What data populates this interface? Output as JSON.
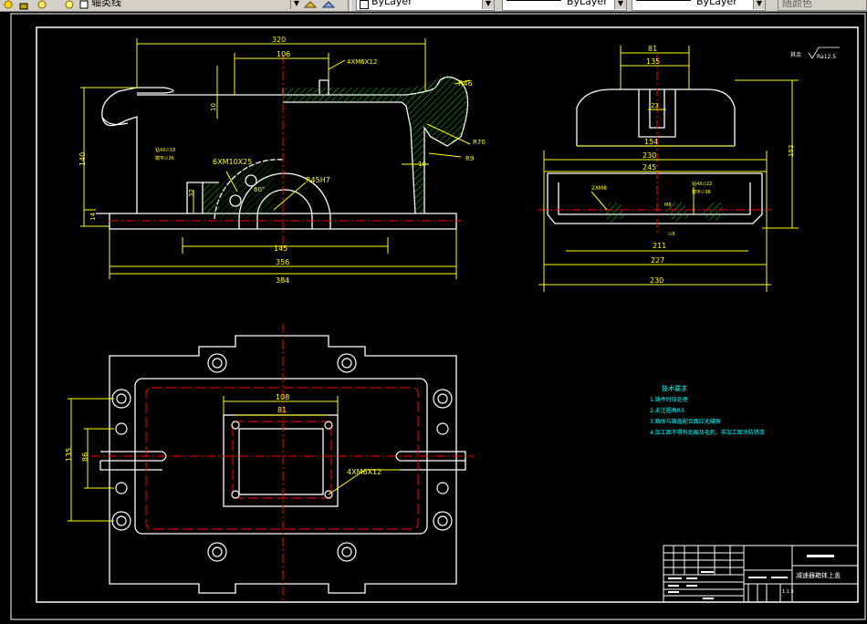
{
  "toolbar": {
    "layer_name": "轴类线",
    "color_value": "ByLayer",
    "linetype_value": "ByLayer",
    "lineweight_value": "ByLayer",
    "plotstyle_value": "随颜色"
  },
  "drawing": {
    "front_view": {
      "dim_320": "320",
      "dim_106": "106",
      "dim_4xm6x12": "4XM6X12",
      "dim_r46": "R46",
      "dim_r70": "R70",
      "dim_r9": "R9",
      "dim_10a": "10",
      "dim_10b": "10",
      "dim_140": "140",
      "dim_6xm10x25": "6XM10X25",
      "dim_60deg": "60°",
      "dim_r45h7": "R45H7",
      "dim_32": "32",
      "dim_14": "14",
      "dim_145": "145",
      "dim_356": "356",
      "dim_384": "384",
      "hole_note_1": "钻4X∅18",
      "hole_note_2": "锪平∅26"
    },
    "side_view": {
      "dim_81": "81",
      "dim_135": "135",
      "dim_23": "23",
      "dim_154": "154",
      "dim_230a": "230",
      "dim_245": "245",
      "dim_2xm8": "2XM8",
      "dim_hole_note_1": "钻4X∅22",
      "dim_hole_note_2": "锪平∅38",
      "dim_m8": "M8",
      "dim_phi8": "∅8",
      "dim_211": "211",
      "dim_227": "227",
      "dim_230b": "230",
      "dim_152": "152",
      "roughness_label": "其余",
      "roughness_value": "Ra12.5"
    },
    "top_view": {
      "dim_108": "108",
      "dim_81": "81",
      "dim_135": "135",
      "dim_86": "86",
      "dim_4xm6x12": "4XM6X12"
    },
    "notes": {
      "title": "技术要求",
      "line1": "1.铸件时效处理",
      "line2": "2.未注圆角R3",
      "line3": "3.箱体与箱盖配合面应无缝隙",
      "line4": "4.加工面不得有划痕及毛刺，非加工面涂防锈漆"
    },
    "title_block": {
      "drawing_title": "减速器箱体上盖",
      "scale": "1:1.5"
    }
  },
  "colors": {
    "line": "#ffffff",
    "dim": "#ffff00",
    "center": "#ff0000",
    "hatch": "#00cc00",
    "note": "#00ffff",
    "background": "#000000"
  }
}
